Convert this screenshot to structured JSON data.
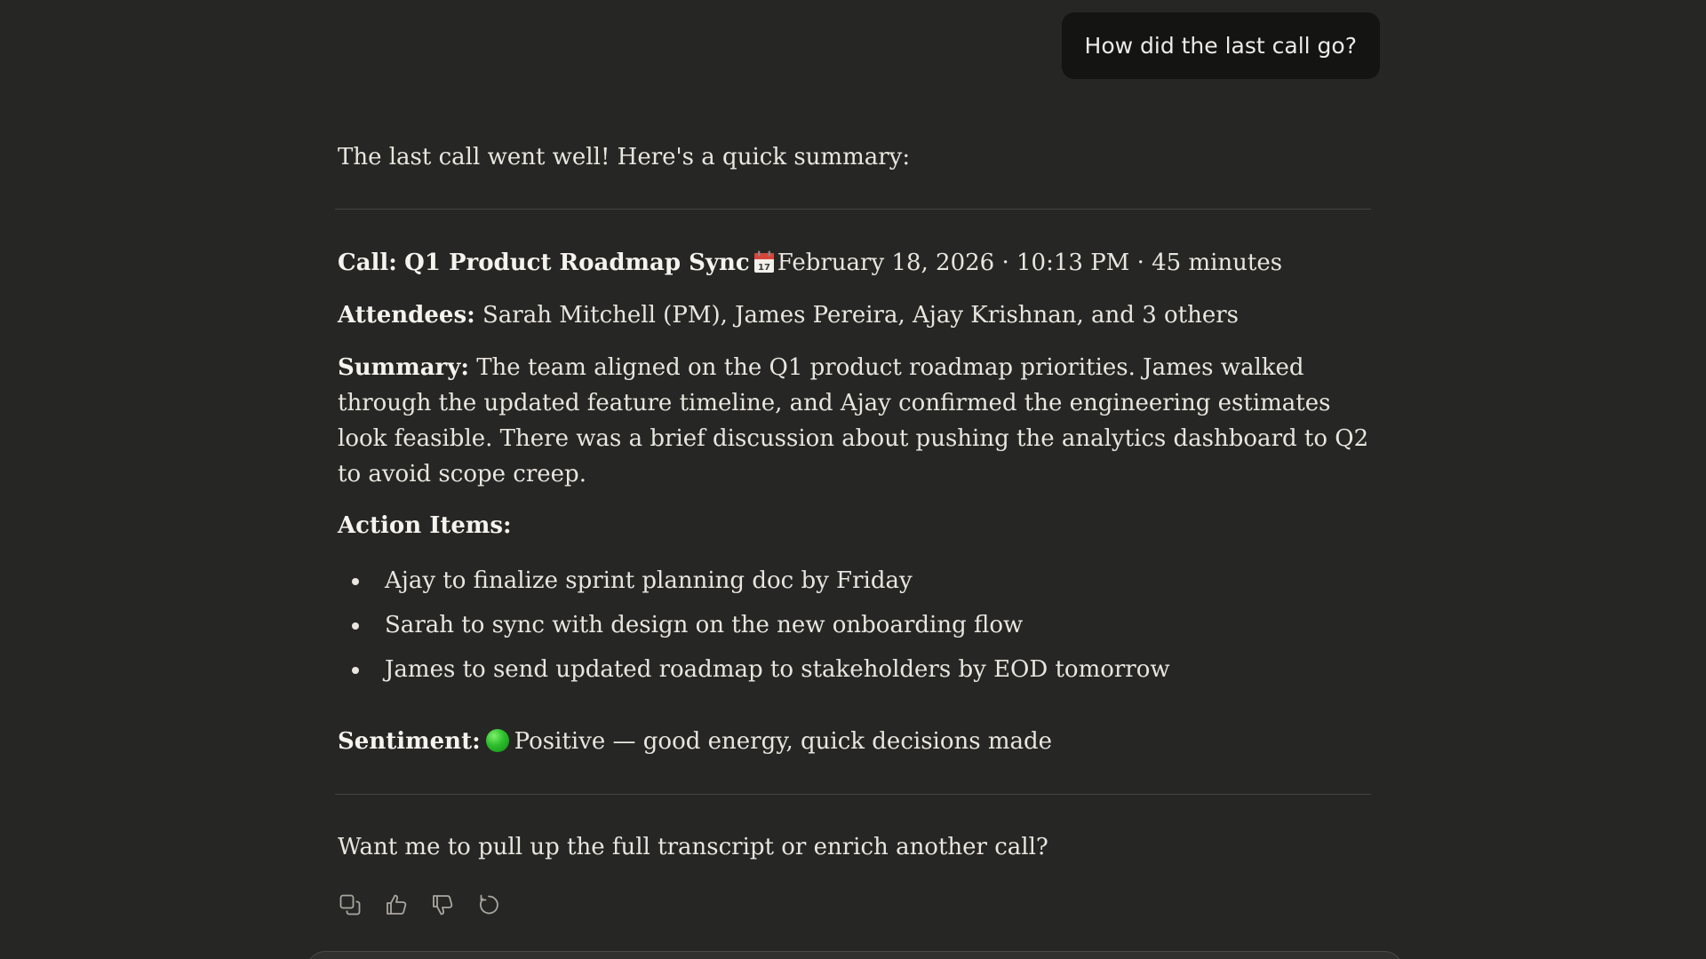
{
  "user_message": "How did the last call go?",
  "assistant": {
    "intro": "The last call went well! Here's a quick summary:",
    "call": {
      "label": "Call:",
      "title": "Q1 Product Roadmap Sync",
      "icon": "calendar-icon",
      "details": "February 18, 2026 · 10:13 PM · 45 minutes"
    },
    "attendees": {
      "label": "Attendees:",
      "value": "Sarah Mitchell (PM), James Pereira, Ajay Krishnan, and 3 others"
    },
    "summary": {
      "label": "Summary:",
      "value": "The team aligned on the Q1 product roadmap priorities. James walked through the updated feature timeline, and Ajay confirmed the engineering estimates look feasible. There was a brief discussion about pushing the analytics dashboard to Q2 to avoid scope creep."
    },
    "action_items": {
      "label": "Action Items:",
      "items": [
        "Ajay to finalize sprint planning doc by Friday",
        "Sarah to sync with design on the new onboarding flow",
        "James to send updated roadmap to stakeholders by EOD tomorrow"
      ]
    },
    "sentiment": {
      "label": "Sentiment:",
      "icon": "green-circle-icon",
      "value": "Positive — good energy, quick decisions made"
    },
    "followup": "Want me to pull up the full transcript or enrich another call?"
  },
  "toolbar": {
    "icons": [
      "copy-icon",
      "thumbs-up-icon",
      "thumbs-down-icon",
      "retry-icon"
    ]
  },
  "colors": {
    "background": "#262624",
    "user_bubble": "#141413",
    "text": "#e8e6df",
    "divider": "#454440",
    "sentiment_green": "#2bbd2a"
  }
}
